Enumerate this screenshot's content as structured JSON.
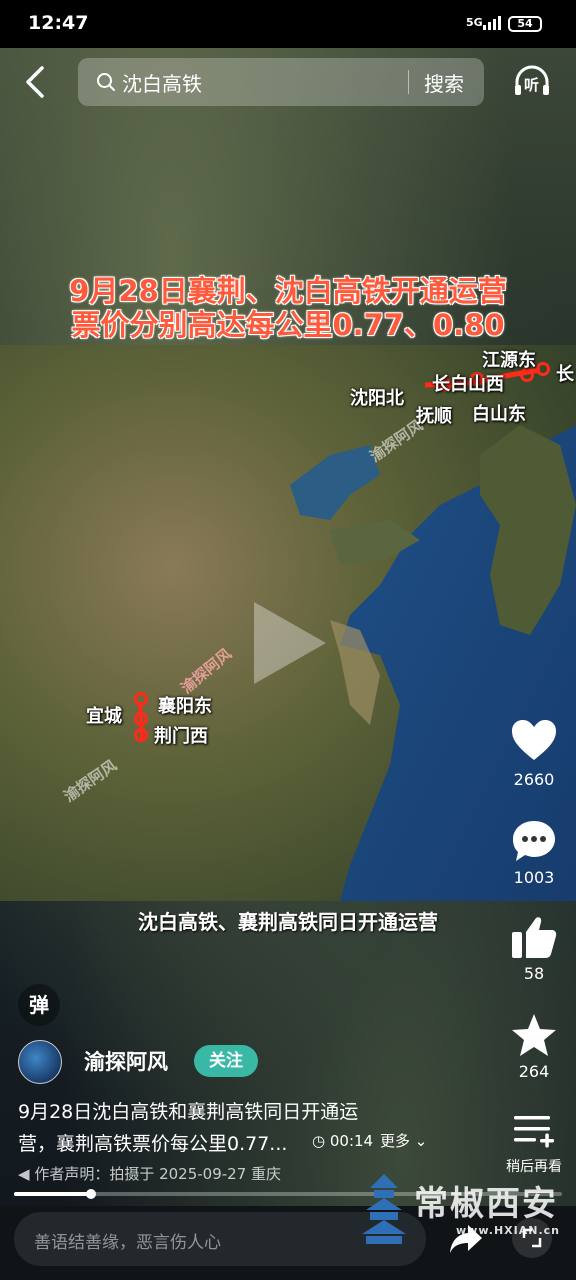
{
  "status_bar": {
    "time": "12:47",
    "network": "5G",
    "battery": "54"
  },
  "search": {
    "query": "沈白高铁",
    "button": "搜索",
    "listen_label": "听"
  },
  "video": {
    "title_line1": "9月28日襄荆、沈白高铁开通运营",
    "title_line2": "票价分别高达每公里0.77、0.80",
    "subtitle": "沈白高铁、襄荆高铁同日开通运营",
    "watermark": "渝探阿风",
    "stations": {
      "jiangyuan_dong": "江源东",
      "shenyang_bei": "沈阳北",
      "changbaishan_xi": "长白山西",
      "chang": "长",
      "fushun": "抚顺",
      "baishan_dong": "白山东",
      "yicheng": "宜城",
      "xiangyang_dong": "襄阳东",
      "jingmen_xi": "荆门西"
    },
    "colors": {
      "title_red": "#ff5a3c",
      "pin_red": "#ff2a1a"
    }
  },
  "actions": {
    "likes": "2660",
    "comments": "1003",
    "recommends": "58",
    "favorites": "264",
    "watch_later_label": "稍后再看"
  },
  "info": {
    "danmu_label": "弹",
    "author": "渝探阿风",
    "follow_label": "关注",
    "desc_line1": "9月28日沈白高铁和襄荆高铁同日开通运",
    "desc_line2": "营，襄荆高铁票价每公里0.77...",
    "duration": "00:14",
    "more_label": "更多",
    "declaration": "作者声明：拍摄于 2025-09-27 重庆",
    "progress": 0.14
  },
  "comment": {
    "placeholder": "善语结善缘，恶言伤人心"
  },
  "brand": {
    "name": "常椒西安",
    "url": "www.HXIAN.cn"
  }
}
